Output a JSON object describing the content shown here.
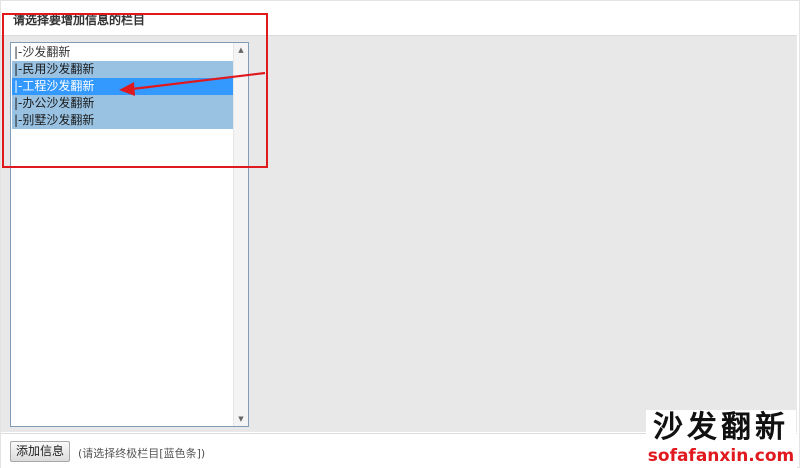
{
  "page": {
    "title": "请选择要增加信息的栏目"
  },
  "category_list": {
    "items": [
      {
        "label": "|-沙发翻新",
        "kind": "parent"
      },
      {
        "label": "|-民用沙发翻新",
        "kind": "leaf"
      },
      {
        "label": "|-工程沙发翻新",
        "kind": "selected"
      },
      {
        "label": "|-办公沙发翻新",
        "kind": "leaf"
      },
      {
        "label": "|-别墅沙发翻新",
        "kind": "leaf"
      }
    ],
    "selected_value": "|-工程沙发翻新",
    "leaf_color": "#99c2e2",
    "selected_color": "#3399ff"
  },
  "scrollbar": {
    "up_icon": "triangle-up-icon",
    "down_icon": "triangle-down-icon"
  },
  "footer": {
    "add_button_label": "添加信息",
    "hint": "(请选择终极栏目[蓝色条])"
  },
  "annotation": {
    "box_color": "#e0191f",
    "arrow_color": "#e0191f"
  },
  "watermark": {
    "chinese": "沙发翻新",
    "url": "sofafanxin.com"
  }
}
